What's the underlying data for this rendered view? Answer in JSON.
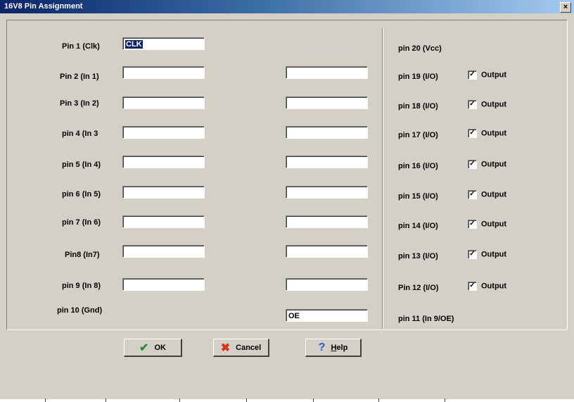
{
  "window": {
    "title": "16V8 Pin Assignment",
    "close_label": "×"
  },
  "left_labels": [
    "Pin 1 (Clk)",
    "Pin 2 (In 1)",
    "Pin 3 (In 2)",
    "pin 4 (In 3",
    "pin 5 (In 4)",
    "pin 6 (In 5)",
    "pin 7 (In 6)",
    "Pin8 (In7)",
    "pin 9 (In 8)",
    "pin 10 (Gnd)"
  ],
  "right_labels": [
    "pin 20 (Vcc)",
    "pin 19 (I/O)",
    "pin 18 (I/O)",
    "pin 17 (I/O)",
    "pin 16 (I/O)",
    "pin 15 (I/O)",
    "pin 14 (I/O)",
    "pin 13 (I/O)",
    "Pin 12 (I/O)",
    "pin 11 (In 9/OE)"
  ],
  "fields": {
    "pin1": "CLK",
    "pin11": "OE"
  },
  "output_checkbox": {
    "label": "Output",
    "mark": "✓"
  },
  "buttons": {
    "ok": "OK",
    "cancel": "Cancel",
    "help": "Help"
  },
  "icons": {
    "ok": "checkmark-icon",
    "cancel": "x-icon",
    "help": "question-icon"
  },
  "colors": {
    "title_start": "#0a246a",
    "title_end": "#a6caf0",
    "ok_icon": "#2e8b2e",
    "cancel_icon": "#d8341c",
    "help_icon": "#1f5fd0"
  }
}
